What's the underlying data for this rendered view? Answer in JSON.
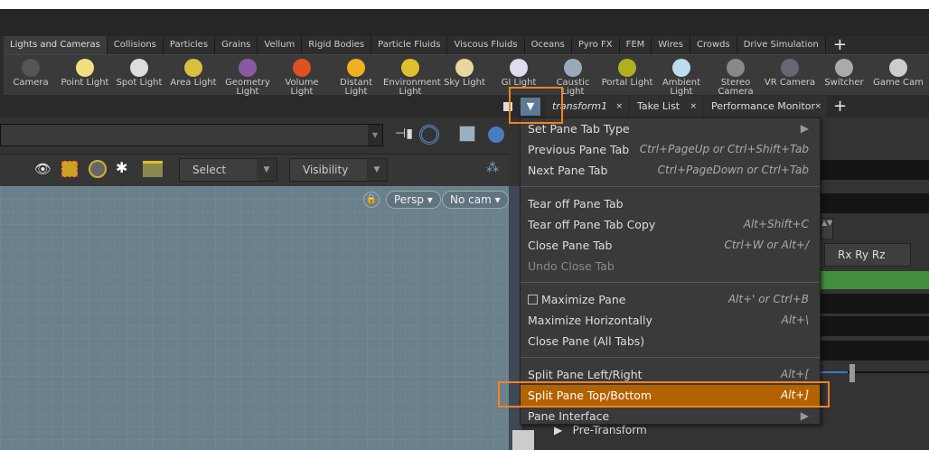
{
  "shelf_tabs": [
    "Lights and Cameras",
    "Collisions",
    "Particles",
    "Grains",
    "Vellum",
    "Rigid Bodies",
    "Particle Fluids",
    "Viscous Fluids",
    "Oceans",
    "Pyro FX",
    "FEM",
    "Wires",
    "Crowds",
    "Drive Simulation"
  ],
  "shelf_add": "+",
  "tools": [
    {
      "label": "Camera",
      "color": "#555"
    },
    {
      "label": "Point Light",
      "color": "#f0e080"
    },
    {
      "label": "Spot Light",
      "color": "#ddd"
    },
    {
      "label": "Area Light",
      "color": "#d8c040"
    },
    {
      "label": "Geometry Light",
      "color": "#8a5aa0"
    },
    {
      "label": "Volume Light",
      "color": "#e05020"
    },
    {
      "label": "Distant Light",
      "color": "#f0b020"
    },
    {
      "label": "Environment Light",
      "color": "#e0c030"
    },
    {
      "label": "Sky Light",
      "color": "#e8d8a0"
    },
    {
      "label": "GI Light",
      "color": "#dde"
    },
    {
      "label": "Caustic Light",
      "color": "#9ab"
    },
    {
      "label": "Portal Light",
      "color": "#b0b020"
    },
    {
      "label": "Ambient Light",
      "color": "#bde"
    },
    {
      "label": "Stereo Camera",
      "color": "#888"
    },
    {
      "label": "VR Camera",
      "color": "#667"
    },
    {
      "label": "Switcher",
      "color": "#aaa"
    },
    {
      "label": "Game Cam",
      "color": "#ccc"
    }
  ],
  "pane_tabs": [
    {
      "label": "transform1",
      "close": "×"
    },
    {
      "label": "Take List",
      "close": "×"
    },
    {
      "label": "Performance Monitor",
      "close": "×"
    }
  ],
  "pane_add": "+",
  "toolbar": {
    "select": "Select",
    "visibility": "Visibility"
  },
  "viewport": {
    "persp": "Persp ▾",
    "cam": "No cam ▾"
  },
  "params": {
    "rot_order": "Rx Ry Rz",
    "pre_transform": "Pre-Transform",
    "accent": "#3f8f3f"
  },
  "menu": {
    "items": [
      {
        "label": "Set Pane Tab Type",
        "shortcut": "▶"
      },
      {
        "label": "Previous Pane Tab",
        "shortcut": "Ctrl+PageUp or Ctrl+Shift+Tab"
      },
      {
        "label": "Next Pane Tab",
        "shortcut": "Ctrl+PageDown or Ctrl+Tab"
      },
      {
        "label": "Tear off Pane Tab",
        "shortcut": ""
      },
      {
        "label": "Tear off Pane Tab Copy",
        "shortcut": "Alt+Shift+C"
      },
      {
        "label": "Close Pane Tab",
        "shortcut": "Ctrl+W or Alt+/"
      },
      {
        "label": "Undo Close Tab",
        "shortcut": "",
        "disabled": true
      },
      {
        "label": "Maximize Pane",
        "shortcut": "Alt+' or Ctrl+B",
        "checkbox": true
      },
      {
        "label": "Maximize Horizontally",
        "shortcut": "Alt+\\"
      },
      {
        "label": "Close Pane (All Tabs)",
        "shortcut": ""
      },
      {
        "label": "Split Pane Left/Right",
        "shortcut": "Alt+["
      },
      {
        "label": "Split Pane Top/Bottom",
        "shortcut": "Alt+]",
        "highlighted": true
      },
      {
        "label": "Pane Interface",
        "shortcut": "▶"
      }
    ],
    "highlight_color": "#b36200",
    "annotation_color": "#f58220"
  }
}
